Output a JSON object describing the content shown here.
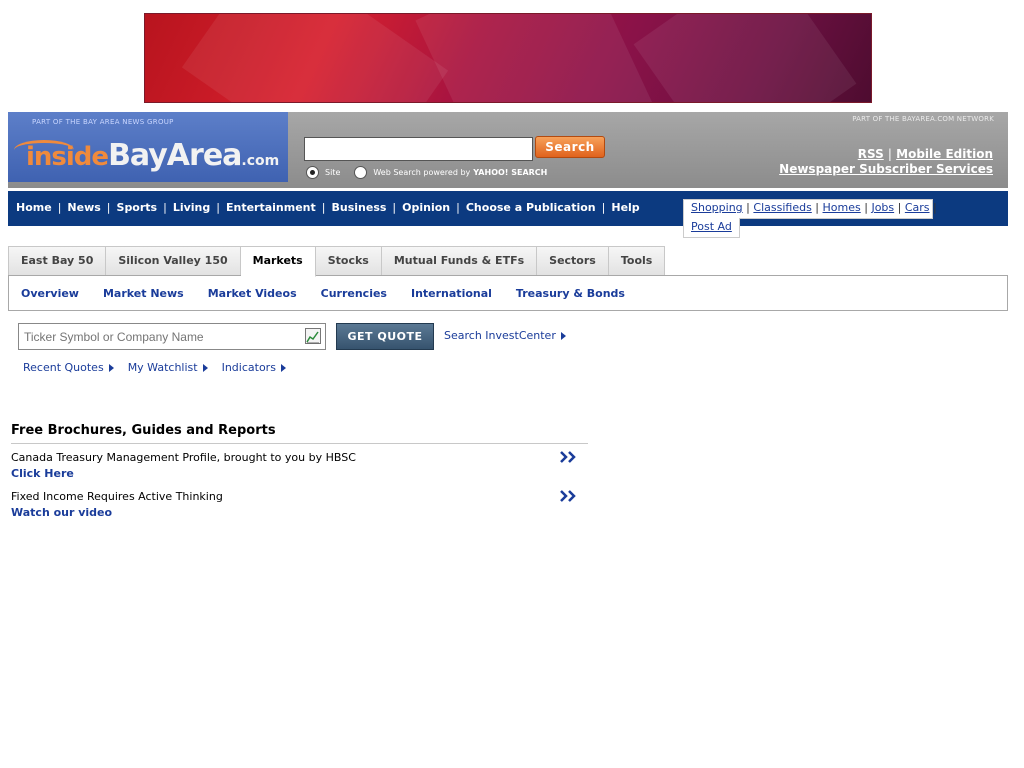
{
  "header": {
    "group_tag": "PART OF THE BAY AREA NEWS GROUP",
    "logo_inside": "inside",
    "logo_bayarea": "BayArea",
    "logo_com": ".com",
    "network_tag": "PART OF THE BAYAREA.COM NETWORK",
    "search_button": "Search",
    "search_input_value": "",
    "search_option_site": "Site",
    "search_option_web": "Web Search powered by",
    "search_yahoo": "YAHOO! SEARCH",
    "rss": "RSS",
    "mobile": "Mobile Edition",
    "subscriber": "Newspaper Subscriber Services"
  },
  "nav": {
    "items": [
      "Home",
      "News",
      "Sports",
      "Living",
      "Entertainment",
      "Business",
      "Opinion",
      "Choose a Publication",
      "Help"
    ]
  },
  "classifieds": {
    "items": [
      "Shopping",
      "Classifieds",
      "Homes",
      "Jobs",
      "Cars"
    ],
    "post_ad": "Post Ad"
  },
  "market_tabs": {
    "items": [
      "East Bay 50",
      "Silicon Valley 150",
      "Markets",
      "Stocks",
      "Mutual Funds & ETFs",
      "Sectors",
      "Tools"
    ],
    "active": "Markets"
  },
  "subnav": {
    "items": [
      "Overview",
      "Market News",
      "Market Videos",
      "Currencies",
      "International",
      "Treasury & Bonds"
    ]
  },
  "quote": {
    "placeholder": "Ticker Symbol or Company Name",
    "button": "GET QUOTE",
    "search_invest": "Search InvestCenter",
    "links": [
      "Recent Quotes",
      "My Watchlist",
      "Indicators"
    ]
  },
  "brochures": {
    "title": "Free Brochures, Guides and Reports",
    "items": [
      {
        "text": "Canada Treasury Management Profile, brought to you by HBSC",
        "link": "Click Here"
      },
      {
        "text": "Fixed Income Requires Active Thinking",
        "link": "Watch our video"
      }
    ]
  },
  "colors": {
    "nav_bg": "#0c3a80",
    "link": "#1a3c9a",
    "search_orange": "#e0621c"
  }
}
